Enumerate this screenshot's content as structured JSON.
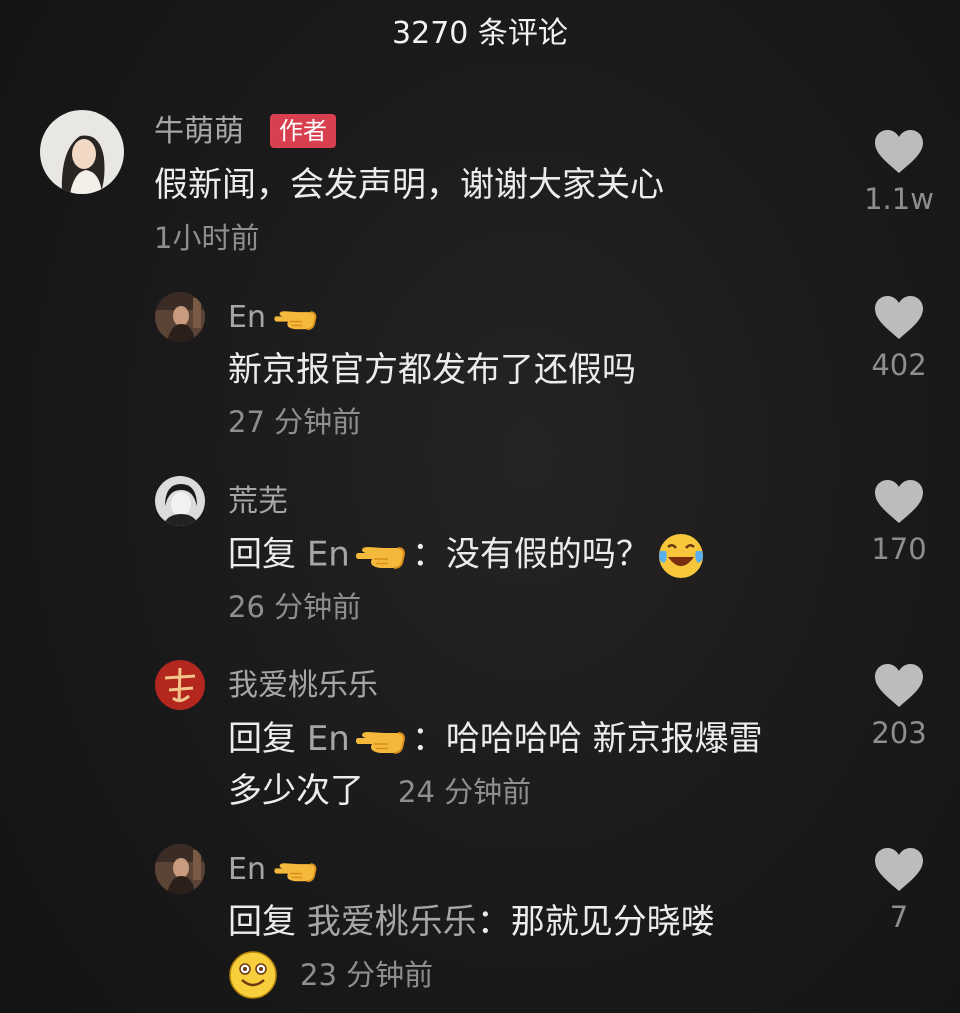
{
  "header": {
    "title": "3270 条评论"
  },
  "comments": [
    {
      "user": "牛萌萌",
      "badge": "作者",
      "text": "假新闻，会发声明，谢谢大家关心",
      "time": "1小时前",
      "likes": "1.1w",
      "avatar_icon": "portrait-avatar-icon"
    },
    {
      "user": "En",
      "text": "新京报官方都发布了还假吗",
      "time": "27 分钟前",
      "likes": "402",
      "avatar_icon": "portrait-avatar-icon"
    },
    {
      "user": "荒芜",
      "reply_prefix": "回复",
      "reply_to": "En",
      "text": "：没有假的吗？",
      "time": "26 分钟前",
      "likes": "170",
      "emoji": "laughing-crying-emoji",
      "avatar_icon": "portrait-avatar-icon"
    },
    {
      "user": "我爱桃乐乐",
      "reply_prefix": "回复",
      "reply_to": "En",
      "text_line1": "：哈哈哈哈 新京报爆雷",
      "text_line2": "多少次了",
      "time": "24 分钟前",
      "likes": "203",
      "avatar_icon": "calligraphy-avatar-icon"
    },
    {
      "user": "En",
      "reply_prefix": "回复",
      "reply_to": "我爱桃乐乐",
      "text": "：那就见分晓喽",
      "time": "23 分钟前",
      "likes": "7",
      "emoji": "smiling-emoji",
      "avatar_icon": "portrait-avatar-icon"
    }
  ],
  "colors": {
    "background": "#161617",
    "badge": "#d9404f",
    "username": "#a7a6a5",
    "text": "#ececec",
    "muted": "#8f8e8d",
    "heart": "#bdbcbb"
  }
}
